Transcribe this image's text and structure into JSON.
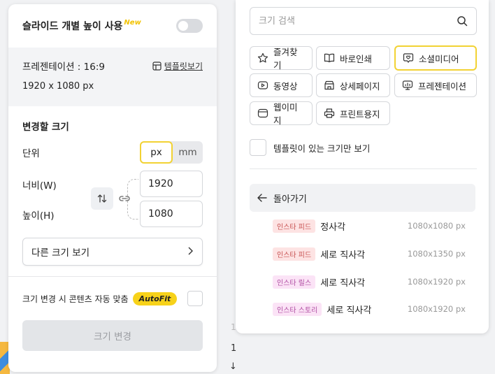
{
  "colors": {
    "accent_yellow": "#f2d233",
    "badge_yellow": "#f7d21a",
    "panel_bg": "#ffffff",
    "muted_bg": "#f3f4f6"
  },
  "left_panel": {
    "title": "슬라이드 개별 높이 사용",
    "new_badge": "New",
    "toggle_on": false,
    "presentation_label": "프레젠테이션 : 16:9",
    "template_link": "템플릿보기",
    "current_size": "1920 x 1080 px",
    "section_title": "변경할 크기",
    "unit_label": "단위",
    "units": [
      "px",
      "mm"
    ],
    "selected_unit": "px",
    "width_label": "너비(W)",
    "height_label": "높이(H)",
    "width_value": "1920",
    "height_value": "1080",
    "other_size_label": "다른 크기 보기",
    "autofit_label": "크기 변경 시 콘텐츠 자동 맞춤",
    "autofit_badge": "AutoFit",
    "autofit_checked": false,
    "resize_button": "크기 변경"
  },
  "pager": {
    "top": "1",
    "current": "1",
    "down_arrow": "↓"
  },
  "right_panel": {
    "search_placeholder": "크기 검색",
    "categories": [
      {
        "label": "즐겨찾기",
        "icon": "star-icon"
      },
      {
        "label": "바로인쇄",
        "icon": "book-icon"
      },
      {
        "label": "소셜미디어",
        "icon": "social-icon",
        "active": true
      },
      {
        "label": "동영상",
        "icon": "video-icon"
      },
      {
        "label": "상세페이지",
        "icon": "shop-icon"
      },
      {
        "label": "프레젠테이션",
        "icon": "presentation-icon"
      },
      {
        "label": "웹이미지",
        "icon": "web-icon"
      },
      {
        "label": "프린트용지",
        "icon": "printer-icon"
      }
    ],
    "template_only_label": "템플릿이 있는 크기만 보기",
    "back_label": "돌아가기",
    "items": [
      {
        "tag": "인스타 피드",
        "tag_type": "feed",
        "name": "정사각",
        "size": "1080x1080 px"
      },
      {
        "tag": "인스타 피드",
        "tag_type": "feed",
        "name": "세로 직사각",
        "size": "1080x1350 px"
      },
      {
        "tag": "인스타 릴스",
        "tag_type": "reels",
        "name": "세로 직사각",
        "size": "1080x1920 px"
      },
      {
        "tag": "인스타 스토리",
        "tag_type": "story",
        "name": "세로 직사각",
        "size": "1080x1920 px"
      }
    ]
  }
}
